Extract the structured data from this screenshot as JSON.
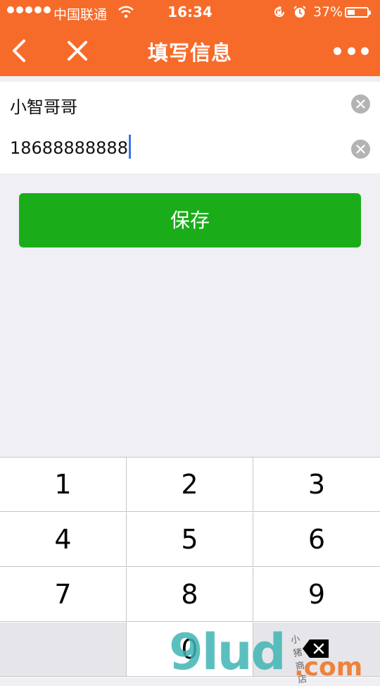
{
  "status_bar": {
    "carrier": "中国联通",
    "time": "16:34",
    "battery_percent": "37%",
    "battery_level": 0.37,
    "icons": [
      "signal-dots-icon",
      "wifi-icon",
      "rotation-lock-icon",
      "alarm-icon",
      "battery-icon"
    ]
  },
  "navbar": {
    "title": "填写信息",
    "back_icon": "chevron-left-icon",
    "close_icon": "close-icon",
    "more_icon": "more-dots-icon"
  },
  "form": {
    "name_value": "小智哥哥",
    "phone_value": "18688888888",
    "clear_icon": "clear-circle-icon"
  },
  "save_button": {
    "label": "保存"
  },
  "keypad": {
    "keys": [
      "1",
      "2",
      "3",
      "4",
      "5",
      "6",
      "7",
      "8",
      "9",
      "",
      "0",
      ""
    ],
    "delete_icon": "backspace-icon"
  },
  "watermark": {
    "main": "9lud",
    "suffix": ".com",
    "small": "小 猪 商 店"
  },
  "colors": {
    "header": "#f76b2a",
    "save_button": "#1aad19",
    "page_background": "#efeff4",
    "cursor": "#3b73e8"
  }
}
